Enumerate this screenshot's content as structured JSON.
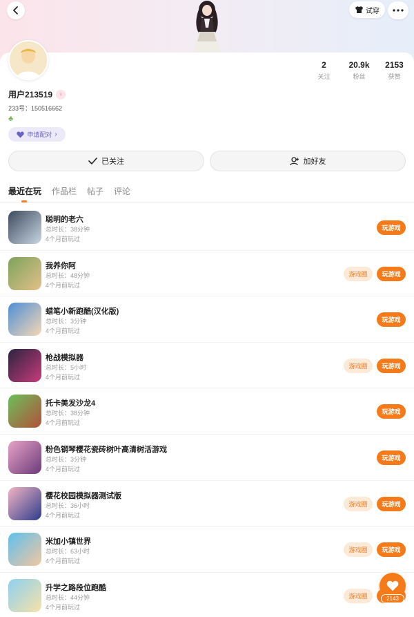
{
  "header": {
    "back_icon": "chevron-left-icon",
    "try_on_label": "试穿",
    "try_on_icon": "shirt-icon",
    "more_icon": "more-dots-icon"
  },
  "profile": {
    "username": "用户213519",
    "user_id_text": "233号：150516662",
    "pair_label": "申请配对",
    "stats": [
      {
        "value": "2",
        "label": "关注"
      },
      {
        "value": "20.9k",
        "label": "粉丝"
      },
      {
        "value": "2153",
        "label": "获赞"
      }
    ],
    "follow_label": "已关注",
    "add_friend_label": "加好友"
  },
  "tabs": [
    {
      "label": "最近在玩",
      "active": true
    },
    {
      "label": "作品栏",
      "active": false
    },
    {
      "label": "帖子",
      "active": false
    },
    {
      "label": "评论",
      "active": false
    }
  ],
  "games": [
    {
      "title": "聪明的老六",
      "duration": "总时长：38分钟",
      "last_played": "4个月前玩过",
      "has_circle": false,
      "play_label": "玩游戏",
      "circle_label": "游戏圈",
      "colors": [
        "#3c4a5e",
        "#c9d6e2"
      ]
    },
    {
      "title": "我养你阿",
      "duration": "总时长：48分钟",
      "last_played": "4个月前玩过",
      "has_circle": true,
      "play_label": "玩游戏",
      "circle_label": "游戏圈",
      "colors": [
        "#7da35c",
        "#e3c089"
      ]
    },
    {
      "title": "蜡笔小新跑酷(汉化版)",
      "duration": "总时长：3分钟",
      "last_played": "4个月前玩过",
      "has_circle": false,
      "play_label": "玩游戏",
      "circle_label": "游戏圈",
      "colors": [
        "#4f8fd6",
        "#f6d8b5"
      ]
    },
    {
      "title": "枪战模拟器",
      "duration": "总时长：5小时",
      "last_played": "4个月前玩过",
      "has_circle": true,
      "play_label": "玩游戏",
      "circle_label": "游戏圈",
      "colors": [
        "#2b2440",
        "#c73b7a"
      ]
    },
    {
      "title": "托卡美发沙龙4",
      "duration": "总时长：38分钟",
      "last_played": "4个月前玩过",
      "has_circle": false,
      "play_label": "玩游戏",
      "circle_label": "游戏圈",
      "colors": [
        "#6cc05a",
        "#b2503a"
      ]
    },
    {
      "title": "粉色钢琴樱花瓷砖树叶高清树活游戏",
      "duration": "总时长：3分钟",
      "last_played": "4个月前玩过",
      "has_circle": false,
      "play_label": "玩游戏",
      "circle_label": "游戏圈",
      "colors": [
        "#e8a3c7",
        "#6b3a7a"
      ]
    },
    {
      "title": "樱花校园模拟器测试版",
      "duration": "总时长：36小时",
      "last_played": "4个月前玩过",
      "has_circle": true,
      "play_label": "玩游戏",
      "circle_label": "游戏圈",
      "colors": [
        "#f3b4c4",
        "#2e3c8c"
      ]
    },
    {
      "title": "米加小镇世界",
      "duration": "总时长：63小时",
      "last_played": "4个月前玩过",
      "has_circle": true,
      "play_label": "玩游戏",
      "circle_label": "游戏圈",
      "colors": [
        "#5ec0ee",
        "#f2c7a0"
      ]
    },
    {
      "title": "升学之路段位跑酷",
      "duration": "总时长：44分钟",
      "last_played": "4个月前玩过",
      "has_circle": true,
      "play_label": "玩游戏",
      "circle_label": "游戏圈",
      "colors": [
        "#8ed0f0",
        "#f6e2a8"
      ]
    }
  ],
  "like_fab": {
    "count": "2143",
    "icon": "heart-icon"
  },
  "colors": {
    "accent": "#f47a1a",
    "circle_bg": "#fde9d8",
    "pair_bg": "#eceaf8"
  }
}
